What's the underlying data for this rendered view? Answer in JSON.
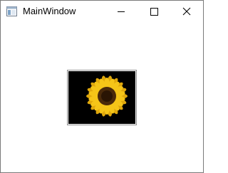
{
  "window": {
    "title": "MainWindow",
    "app_icon": "application-window-icon",
    "caption_buttons": {
      "minimize_icon": "minimize-icon",
      "maximize_icon": "maximize-icon",
      "close_icon": "close-icon"
    }
  },
  "content": {
    "image": {
      "subject_icon": "sunflower-image",
      "colors": {
        "background": "#000000",
        "petals": "#f5c518",
        "petal_shade": "#e0a80c",
        "center": "#4a2a0a",
        "center_dark": "#2a1504"
      }
    }
  }
}
